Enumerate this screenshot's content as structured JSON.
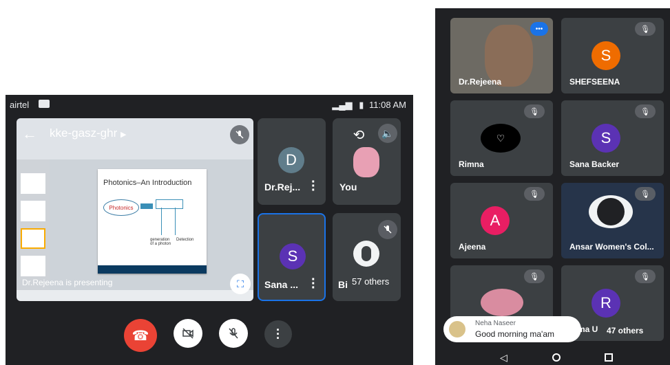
{
  "left": {
    "status": {
      "carrier": "airtel",
      "time": "11:08 AM"
    },
    "meeting": {
      "code": "kke-gasz-ghr",
      "presenting": "Dr.Rejeena is presenting"
    },
    "slide": {
      "title": "Photonics–An Introduction",
      "box_label": "Photonics",
      "label_a": "generation\nof a photon",
      "label_b": "Detection"
    },
    "tiles": [
      {
        "initial": "D",
        "name": "Dr.Rej...",
        "color": "#607d8b"
      },
      {
        "name": "You"
      },
      {
        "initial": "S",
        "name": "Sana ...",
        "color": "#5b32b4"
      },
      {
        "name": "Bi",
        "others": "57 others"
      }
    ]
  },
  "right": {
    "tiles": [
      {
        "name": "Dr.Rejeena"
      },
      {
        "initial": "S",
        "name": "SHEFSEENA",
        "color": "#ef6c00"
      },
      {
        "name": "Rimna"
      },
      {
        "initial": "S",
        "name": "Sana Backer",
        "color": "#5b32b4"
      },
      {
        "initial": "A",
        "name": "Ajeena",
        "color": "#e91e63"
      },
      {
        "name": "Ansar Women's Col..."
      },
      {
        "name": ""
      },
      {
        "initial": "R",
        "name": "Rima U",
        "color": "#5b32b4",
        "others": "47 others"
      }
    ],
    "chat": {
      "sender": "Neha Naseer",
      "message": "Good morning ma'am"
    }
  },
  "colors": {
    "end_call": "#ea4335",
    "selected_border": "#1a73e8",
    "background": "#202124",
    "tile": "#3c4043"
  }
}
